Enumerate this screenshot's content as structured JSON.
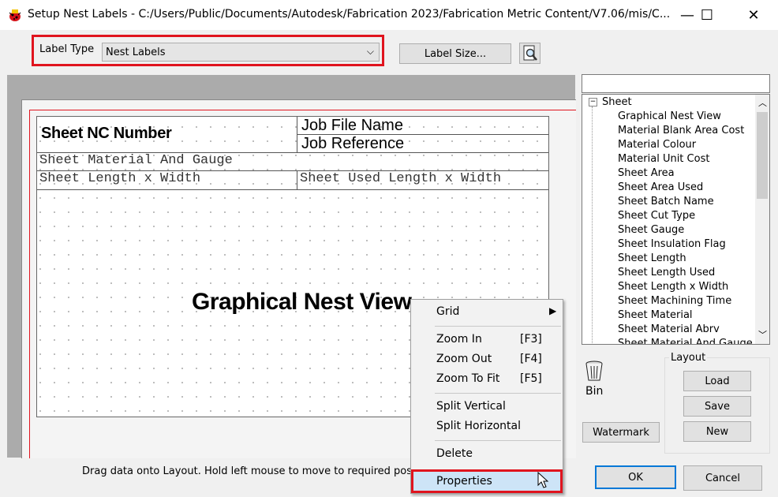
{
  "window": {
    "title": "Setup Nest Labels - C:/Users/Public/Documents/Autodesk/Fabrication 2023/Fabrication Metric Content/V7.06/mis/C...",
    "minimize_glyph": "—",
    "maximize_glyph": "☐",
    "close_glyph": "✕"
  },
  "label_type": {
    "label": "Label Type",
    "value": "Nest Labels",
    "arrow": "⌵"
  },
  "toolbar": {
    "label_size": "Label Size..."
  },
  "layout": {
    "sheet_nc_number": "Sheet NC Number",
    "job_file_name": "Job File Name",
    "job_reference": "Job Reference",
    "sheet_material_gauge": "Sheet Material And Gauge",
    "sheet_length_width": "Sheet Length x Width",
    "sheet_used_length_width": "Sheet Used Length x Width",
    "graphical_nest_view": "Graphical Nest View"
  },
  "tree": {
    "root": "Sheet",
    "items": [
      "Graphical Nest View",
      "Material Blank Area Cost",
      "Material Colour",
      "Material Unit Cost",
      "Sheet Area",
      "Sheet Area Used",
      "Sheet Batch Name",
      "Sheet Cut Type",
      "Sheet Gauge",
      "Sheet Insulation Flag",
      "Sheet Length",
      "Sheet Length Used",
      "Sheet Length x Width",
      "Sheet Machining Time",
      "Sheet Material",
      "Sheet Material Abrv",
      "Sheet Material And Gauge"
    ]
  },
  "bin": {
    "label": "Bin"
  },
  "buttons": {
    "watermark": "Watermark",
    "layout_group": "Layout",
    "load": "Load",
    "save": "Save",
    "new": "New",
    "ok": "OK",
    "cancel": "Cancel"
  },
  "status": "Drag data onto Layout. Hold left mouse to move to required position. D",
  "context_menu": {
    "grid": "Grid",
    "zoom_in": "Zoom In",
    "zoom_in_key": "[F3]",
    "zoom_out": "Zoom Out",
    "zoom_out_key": "[F4]",
    "zoom_to_fit": "Zoom To Fit",
    "zoom_to_fit_key": "[F5]",
    "split_vertical": "Split Vertical",
    "split_horizontal": "Split Horizontal",
    "delete": "Delete",
    "properties": "Properties"
  },
  "colors": {
    "highlight_red": "#e0141e",
    "selection_blue": "#cde4f7"
  }
}
